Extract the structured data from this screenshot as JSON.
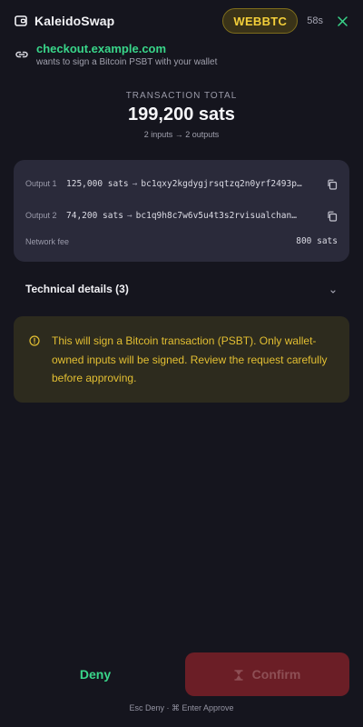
{
  "header": {
    "app_title": "KaleidoSwap",
    "network_badge": "WEBBTC",
    "timer": "58s",
    "icons": {
      "wallet": "wallet-icon",
      "close": "close-icon"
    }
  },
  "origin": {
    "domain": "checkout.example.com",
    "description": "wants to sign a Bitcoin PSBT with your wallet",
    "icon": "link-icon"
  },
  "transaction": {
    "label": "TRANSACTION TOTAL",
    "amount": "199,200 sats",
    "summary": "2 inputs → 2 outputs"
  },
  "outputs": [
    {
      "label": "Output 1",
      "amount": "125,000 sats",
      "arrow": "→",
      "address": "bc1qxy2kgdygjrsqtzq2n0yrf2493p…"
    },
    {
      "label": "Output 2",
      "amount": "74,200 sats",
      "arrow": "→",
      "address": "bc1q9h8c7w6v5u4t3s2rvisualchan…"
    }
  ],
  "fee": {
    "label": "Network fee",
    "value": "800 sats"
  },
  "technical_details": {
    "label": "Technical details (3)"
  },
  "warning": {
    "text": "This will sign a Bitcoin transaction (PSBT). Only wallet-owned inputs will be signed. Review the request carefully before approving."
  },
  "actions": {
    "deny_label": "Deny",
    "confirm_label": "Confirm",
    "shortcuts": "Esc Deny · ⌘ Enter Approve"
  },
  "colors": {
    "background": "#15151e",
    "accent_green": "#39d68a",
    "badge_yellow": "#f4cf3a",
    "warning_text": "#e3bf32",
    "confirm_bg": "#6b1e26"
  }
}
